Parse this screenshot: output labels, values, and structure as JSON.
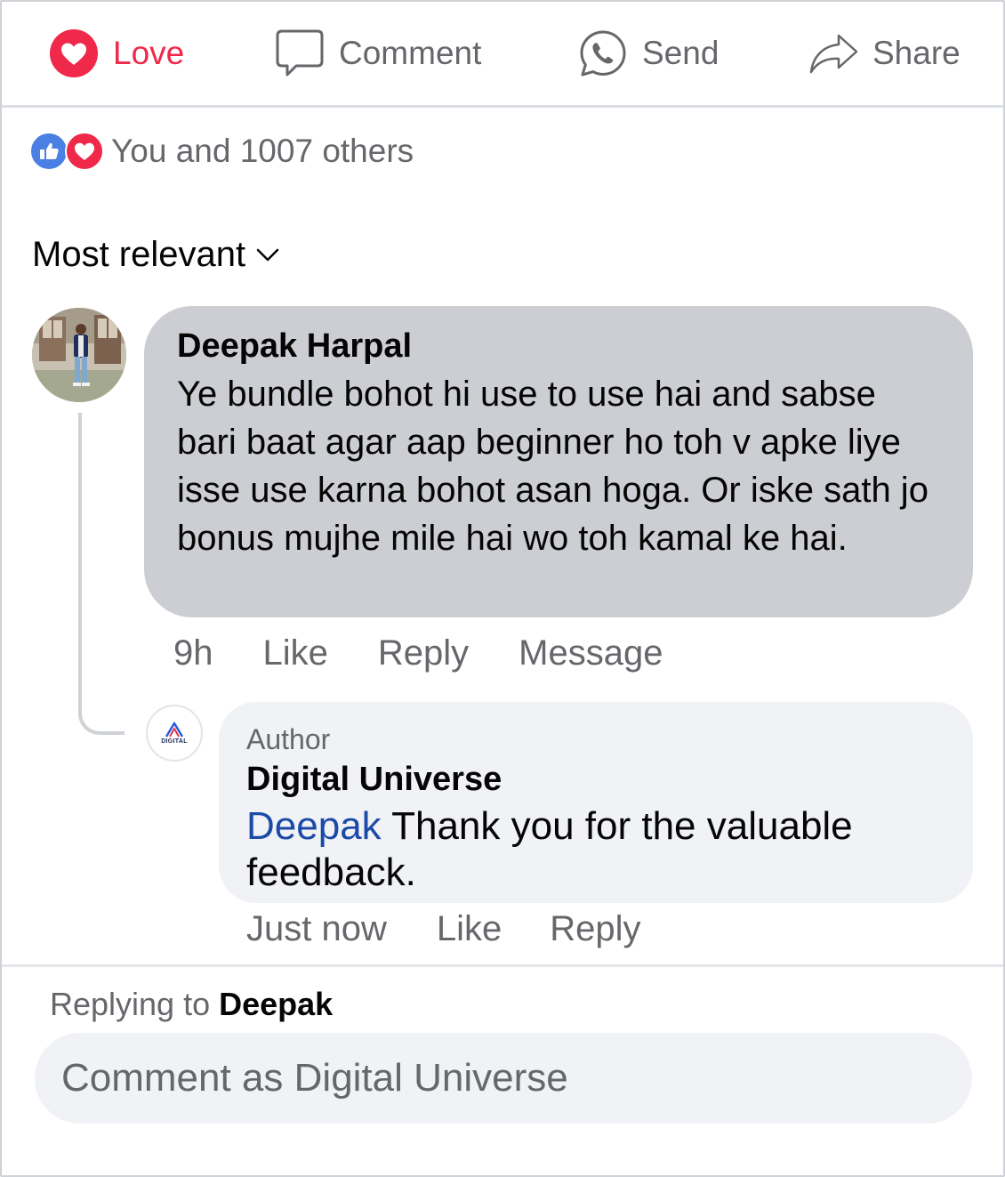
{
  "actions": {
    "love": "Love",
    "comment": "Comment",
    "send": "Send",
    "share": "Share"
  },
  "reactions": {
    "icons": [
      "like-icon",
      "love-icon"
    ],
    "summary": "You and 1007 others"
  },
  "sort": {
    "label": "Most relevant",
    "icon": "chevron-down-icon"
  },
  "comments": [
    {
      "author": "Deepak Harpal",
      "text": "Ye bundle bohot hi use to use hai and sabse bari baat agar aap beginner ho toh v apke liye isse use karna bohot asan hoga. Or iske sath jo bonus mujhe mile hai wo toh kamal ke hai.",
      "time": "9h",
      "actions": [
        "Like",
        "Reply",
        "Message"
      ],
      "replies": [
        {
          "badge": "Author",
          "author": "Digital Universe",
          "mention": "Deepak",
          "text": "Thank you for the valuable feedback.",
          "time": "Just now",
          "actions": [
            "Like",
            "Reply"
          ]
        }
      ]
    }
  ],
  "composer": {
    "replying_prefix": "Replying to",
    "replying_name": "Deepak",
    "placeholder": "Comment as Digital Universe"
  },
  "colors": {
    "love": "#f02849",
    "like": "#4a7fe3",
    "secondary_text": "#65676b",
    "mention": "#1b4aa8",
    "bubble_main": "#ccced3",
    "bubble_reply": "#f0f2f5"
  }
}
